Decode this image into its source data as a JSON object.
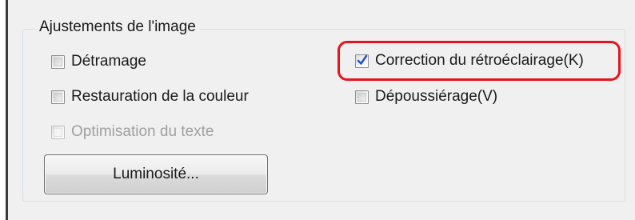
{
  "group": {
    "title": "Ajustements de l'image"
  },
  "options": {
    "descreening": {
      "label": "Détramage",
      "checked": false,
      "enabled": true
    },
    "backlight": {
      "label": "Correction du rétroéclairage(K)",
      "checked": true,
      "enabled": true
    },
    "color_restoration": {
      "label": "Restauration de la couleur",
      "checked": false,
      "enabled": true
    },
    "dust_removal": {
      "label": "Dépoussiérage(V)",
      "checked": false,
      "enabled": true
    },
    "text_enhancement": {
      "label": "Optimisation du texte",
      "checked": false,
      "enabled": false
    }
  },
  "buttons": {
    "brightness_label": "Luminosité..."
  },
  "colors": {
    "highlight": "#e8131b",
    "dialog_background": "#f0f0f0",
    "check_mark": "#2a56c6"
  }
}
